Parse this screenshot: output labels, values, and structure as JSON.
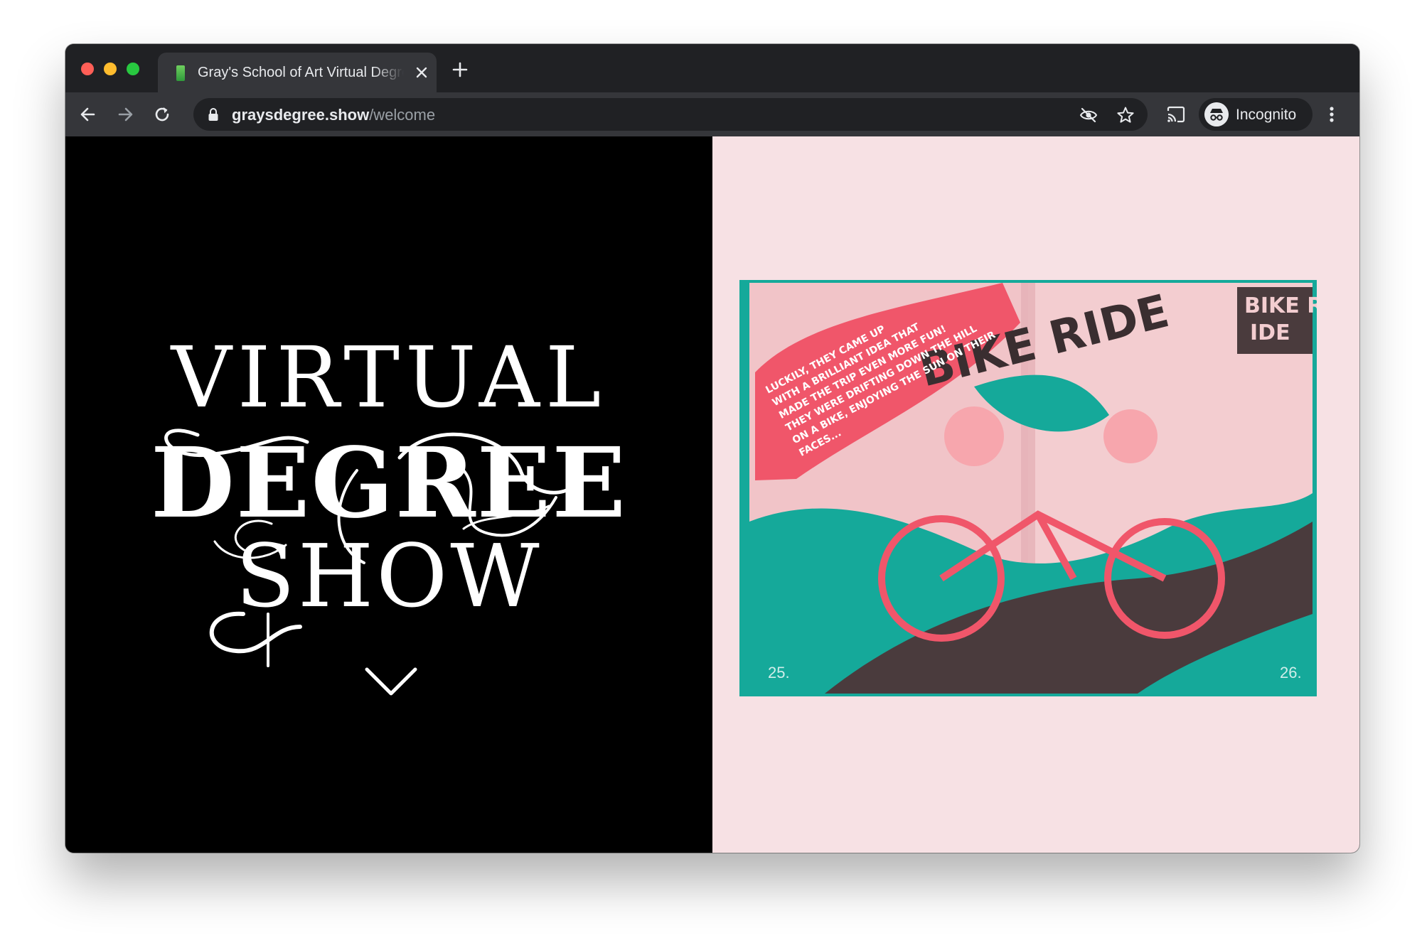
{
  "browser": {
    "tab": {
      "title": "Gray's School of Art Virtual Degree Show",
      "close_icon": "close-icon"
    },
    "new_tab_icon": "plus-icon",
    "nav": {
      "back_icon": "arrow-left-icon",
      "forward_icon": "arrow-right-icon",
      "reload_icon": "reload-icon"
    },
    "address": {
      "host": "graysdegree.show",
      "path": "/welcome",
      "lock_icon": "lock-icon"
    },
    "profile": {
      "label": "Incognito",
      "icon": "incognito-icon"
    }
  },
  "page": {
    "hero_title": {
      "line1": "VIRTUAL",
      "line2": "DEGREE",
      "line3": "SHOW"
    },
    "scroll_icon": "chevron-down-icon",
    "artwork": {
      "heading": "BIKE RIDE",
      "corner_label_1": "BIKE R",
      "corner_label_2": "IDE",
      "story_lines": [
        "LUCKILY, THEY CAME UP",
        "WITH A BRILLIANT IDEA THAT",
        "MADE THE TRIP EVEN MORE FUN!",
        "THEY WERE DRIFTING DOWN THE HILL",
        "ON A BIKE, ENJOYING THE SUN ON THEIR",
        "FACES..."
      ],
      "page_left": "25.",
      "page_right": "26."
    }
  },
  "colors": {
    "chrome_dark": "#202124",
    "chrome_mid": "#35363a",
    "hero_left_bg": "#000000",
    "hero_right_bg": "#f7e1e4",
    "accent_teal": "#15a99a",
    "accent_coral": "#f0566a"
  }
}
